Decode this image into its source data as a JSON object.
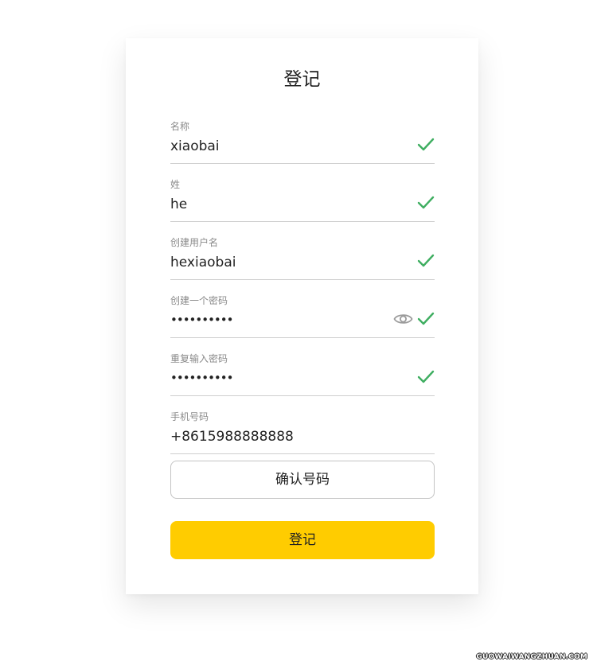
{
  "form": {
    "title": "登记",
    "fields": [
      {
        "label": "名称",
        "value": "xiaobai",
        "valid": true,
        "type": "text"
      },
      {
        "label": "姓",
        "value": "he",
        "valid": true,
        "type": "text"
      },
      {
        "label": "创建用户名",
        "value": "hexiaobai",
        "valid": true,
        "type": "text"
      },
      {
        "label": "创建一个密码",
        "value": "••••••••••",
        "valid": true,
        "type": "password",
        "show_toggle": true
      },
      {
        "label": "重复输入密码",
        "value": "••••••••••",
        "valid": true,
        "type": "password"
      },
      {
        "label": "手机号码",
        "value": "+8615988888888",
        "valid": false,
        "type": "tel"
      }
    ],
    "confirm_phone_label": "确认号码",
    "submit_label": "登记"
  },
  "colors": {
    "check": "#3fae61",
    "primary": "#ffcc00",
    "eye": "#9b9b9b"
  },
  "icons": {
    "check": "check-icon",
    "eye": "eye-icon"
  },
  "watermark": "GUOWAIWANGZHUAN.COM"
}
